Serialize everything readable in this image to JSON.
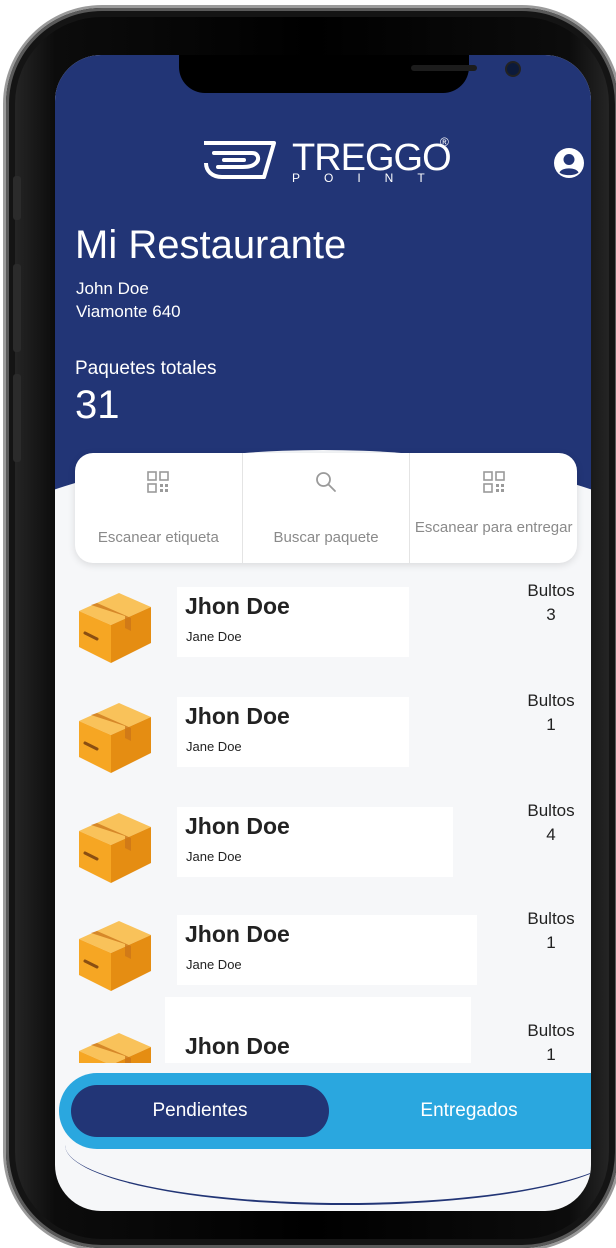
{
  "brand": {
    "wordmark": "TREGGO",
    "registered": "®",
    "subtitle": "POINT"
  },
  "header": {
    "title": "Mi Restaurante",
    "owner": "John Doe",
    "address": "Viamonte 640",
    "total_label": "Paquetes totales",
    "total_value": "31"
  },
  "actions": [
    {
      "label": "Escanear etiqueta",
      "icon": "qr-icon"
    },
    {
      "label": "Buscar paquete",
      "icon": "search-icon"
    },
    {
      "label": "Escanear para entregar",
      "icon": "qr-icon"
    }
  ],
  "packages": [
    {
      "name": "Jhon Doe",
      "subtitle": "Jane Doe",
      "bultos_label": "Bultos",
      "bultos": "3"
    },
    {
      "name": "Jhon Doe",
      "subtitle": "Jane Doe",
      "bultos_label": "Bultos",
      "bultos": "1"
    },
    {
      "name": "Jhon Doe",
      "subtitle": "Jane Doe",
      "bultos_label": "Bultos",
      "bultos": "4"
    },
    {
      "name": "Jhon Doe",
      "subtitle": "Jane Doe",
      "bultos_label": "Bultos",
      "bultos": "1"
    },
    {
      "name": "Jhon Doe",
      "subtitle": "",
      "bultos_label": "Bultos",
      "bultos": "1"
    }
  ],
  "tabs": {
    "active": "Pendientes",
    "other": "Entregados"
  },
  "colors": {
    "primary": "#223576",
    "accent": "#2aa7df",
    "background": "#f6f7f9",
    "box": "#f6a623"
  }
}
